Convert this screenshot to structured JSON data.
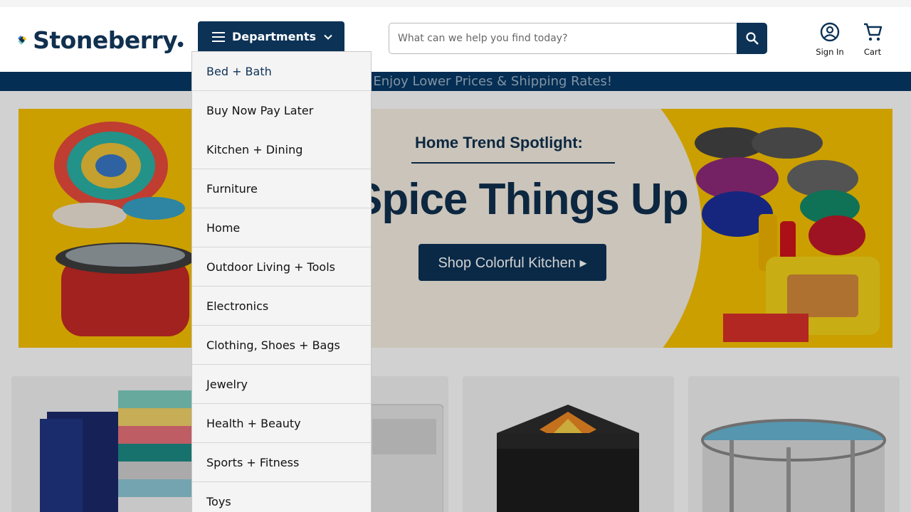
{
  "brand": {
    "name": "Stoneberry",
    "colors": {
      "navy": "#0c3256",
      "promo": "#063966",
      "yellow": "#f8c200"
    }
  },
  "header": {
    "departments_label": "Departments",
    "search": {
      "placeholder": "What can we help you find today?",
      "button_icon": "search-icon"
    },
    "sign_in_label": "Sign In",
    "cart_label": "Cart"
  },
  "promo_bar": {
    "text": "u! Enjoy Lower Prices & Shipping Rates!"
  },
  "hero": {
    "kicker": "Home Trend Spotlight:",
    "headline": "Spice Things Up",
    "cta_label": "Shop Colorful Kitchen ▸"
  },
  "departments_menu": {
    "items": [
      {
        "label": "Bed + Bath"
      },
      {
        "label": "Buy Now Pay Later"
      },
      {
        "label": "Kitchen + Dining"
      },
      {
        "label": "Furniture"
      },
      {
        "label": "Home"
      },
      {
        "label": "Outdoor Living + Tools"
      },
      {
        "label": "Electronics"
      },
      {
        "label": "Clothing, Shoes + Bags"
      },
      {
        "label": "Jewelry"
      },
      {
        "label": "Health + Beauty"
      },
      {
        "label": "Sports + Fitness"
      },
      {
        "label": "Toys"
      }
    ]
  }
}
